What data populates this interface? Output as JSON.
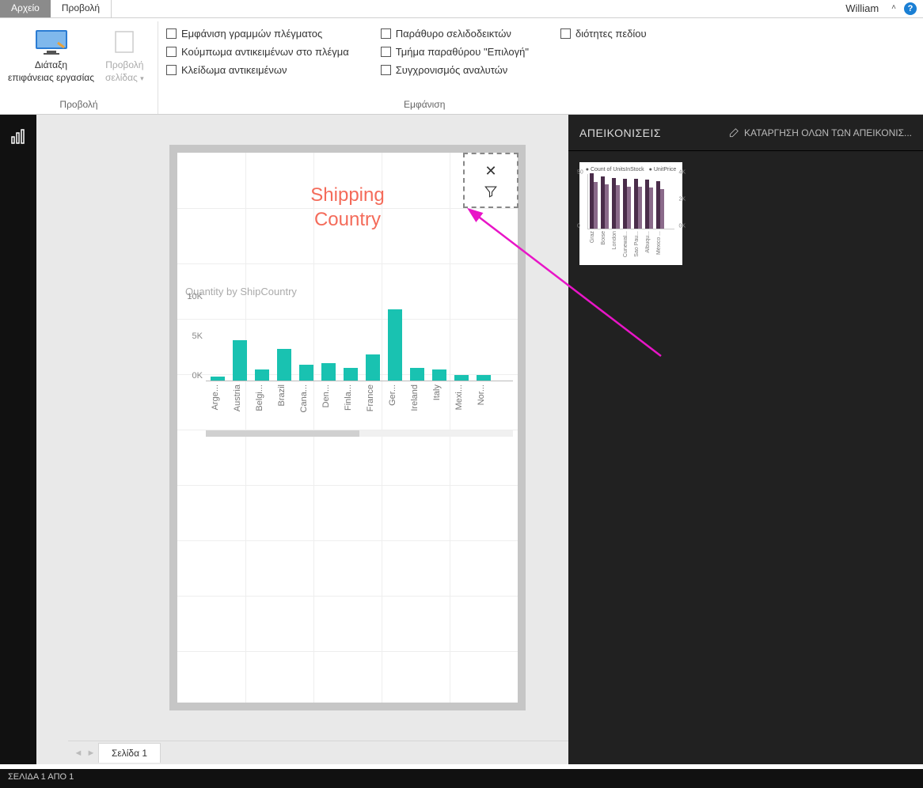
{
  "titlebar": {
    "file_tab": "Αρχείο",
    "active_tab": "Προβολή",
    "user": "William"
  },
  "ribbon": {
    "group1": {
      "label": "Προβολή",
      "btn1_l1": "Διάταξη",
      "btn1_l2": "επιφάνειας εργασίας",
      "btn2_l1": "Προβολή",
      "btn2_l2": "σελίδας"
    },
    "col1": {
      "a": "Εμφάνιση γραμμών πλέγματος",
      "b": "Κούμπωμα αντικειμένων στο πλέγμα",
      "c": "Κλείδωμα αντικειμένων"
    },
    "col2": {
      "a": "Παράθυρο σελιδοδεικτών",
      "b": "Τμήμα παραθύρου \"Επιλογή\"",
      "c": "Συγχρονισμός αναλυτών"
    },
    "col3": {
      "a": "διότητες πεδίου"
    },
    "group2_label": "Εμφάνιση"
  },
  "canvas": {
    "visual_title_l1": "Shipping",
    "visual_title_l2": "Country"
  },
  "chart_data": {
    "type": "bar",
    "title": "Quantity by ShipCountry",
    "ylabel": "",
    "ylim": [
      0,
      10000
    ],
    "yticks": [
      "0K",
      "5K",
      "10K"
    ],
    "categories": [
      "Arge...",
      "Austria",
      "Belgi...",
      "Brazil",
      "Cana...",
      "Den...",
      "Finla...",
      "France",
      "Ger...",
      "Ireland",
      "Italy",
      "Mexi...",
      "Nor..."
    ],
    "values": [
      500,
      5100,
      1400,
      4000,
      2000,
      2200,
      1600,
      3300,
      9000,
      1600,
      1400,
      700,
      700
    ],
    "color": "#19c2b1"
  },
  "thumb_chart": {
    "legend": [
      "Count of UnitsInStock",
      "UnitPrice"
    ],
    "left_ticks": [
      "0",
      "50"
    ],
    "right_ticks": [
      "0K",
      "2K",
      "4K"
    ],
    "categories": [
      "Graz",
      "Boise",
      "London",
      "Cunewal...",
      "Sao Pau...",
      "Albuqu...",
      "México ..."
    ],
    "primary": [
      50,
      47,
      46,
      45,
      45,
      44,
      43
    ],
    "secondary": [
      42,
      40,
      39,
      38,
      38,
      37,
      36
    ]
  },
  "pagetabs": {
    "tab1": "Σελίδα 1"
  },
  "rightpanel": {
    "title": "ΑΠΕΙΚΟΝΙΣΕΙΣ",
    "clear_all": "ΚΑΤΑΡΓΗΣΗ ΟΛΩΝ ΤΩΝ ΑΠΕΙΚΟΝΙΣ..."
  },
  "status": {
    "text": "ΣΕΛΙΔΑ 1 ΑΠΟ 1"
  }
}
